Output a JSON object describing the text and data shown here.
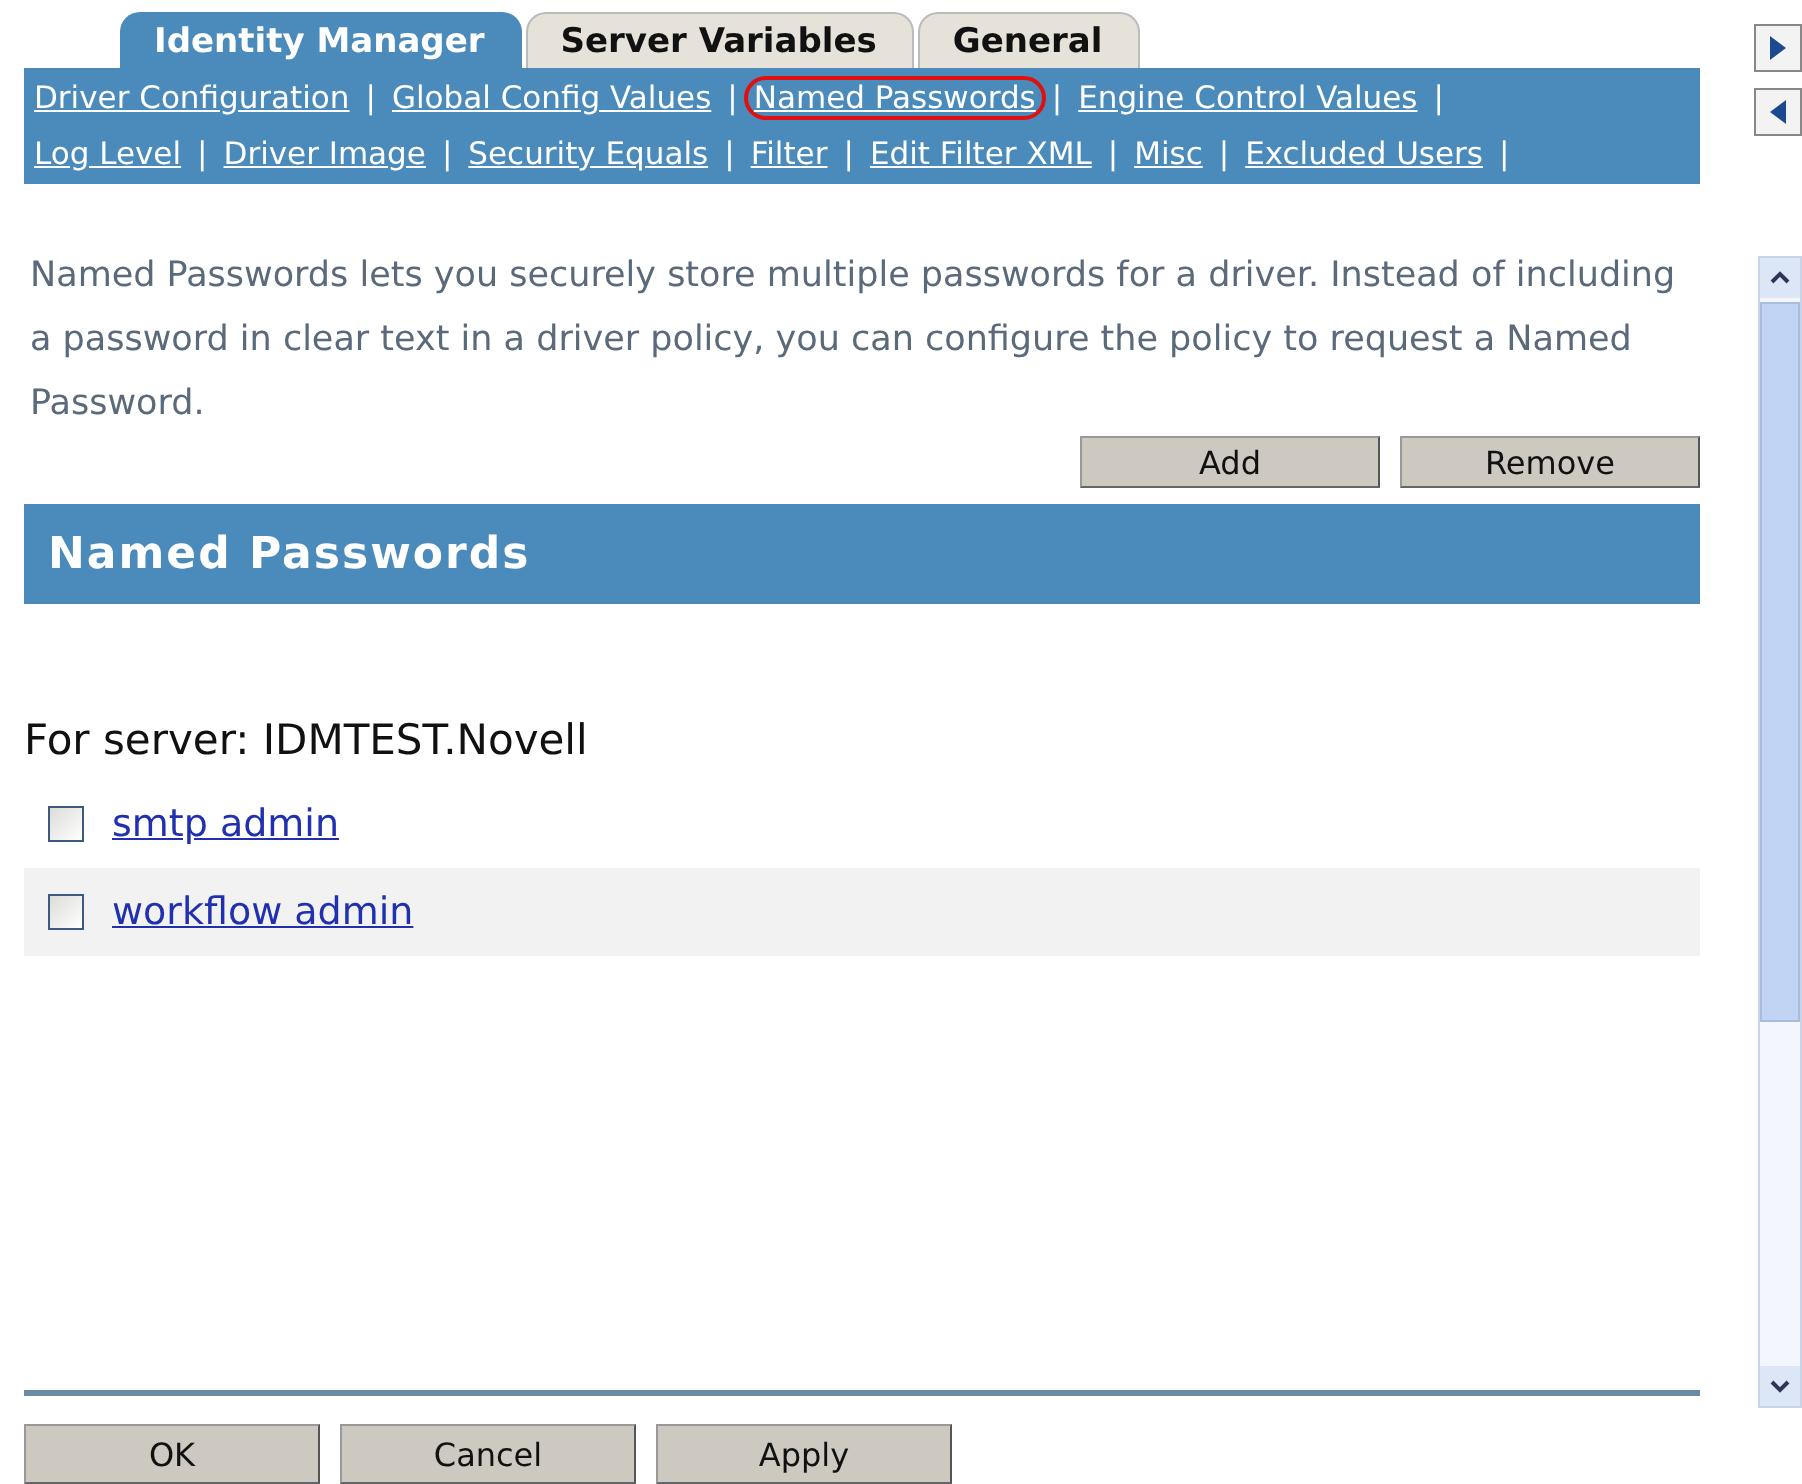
{
  "tabs": [
    {
      "label": "Identity Manager",
      "selected": true
    },
    {
      "label": "Server Variables",
      "selected": false
    },
    {
      "label": "General",
      "selected": false
    }
  ],
  "nav_rows": [
    [
      {
        "label": "Driver Configuration",
        "selected": false
      },
      {
        "label": "Global Config Values",
        "selected": false
      },
      {
        "label": "Named Passwords",
        "selected": true
      },
      {
        "label": "Engine Control Values",
        "selected": false
      }
    ],
    [
      {
        "label": "Log Level",
        "selected": false
      },
      {
        "label": "Driver Image",
        "selected": false
      },
      {
        "label": "Security Equals",
        "selected": false
      },
      {
        "label": "Filter",
        "selected": false
      },
      {
        "label": "Edit Filter XML",
        "selected": false
      },
      {
        "label": "Misc",
        "selected": false
      },
      {
        "label": "Excluded Users",
        "selected": false
      }
    ]
  ],
  "separator": "|",
  "description": "Named Passwords lets you securely store multiple passwords for a driver. Instead of including a password in clear text in a driver policy, you can configure the policy to request a Named Password.",
  "list_buttons": [
    "Add",
    "Remove"
  ],
  "section_title": "Named Passwords",
  "server_label": "For server: IDMTEST.Novell",
  "passwords": [
    {
      "name": "smtp admin",
      "checked": false
    },
    {
      "name": "workflow admin",
      "checked": false
    }
  ],
  "footer_buttons": [
    "OK",
    "Cancel",
    "Apply"
  ]
}
